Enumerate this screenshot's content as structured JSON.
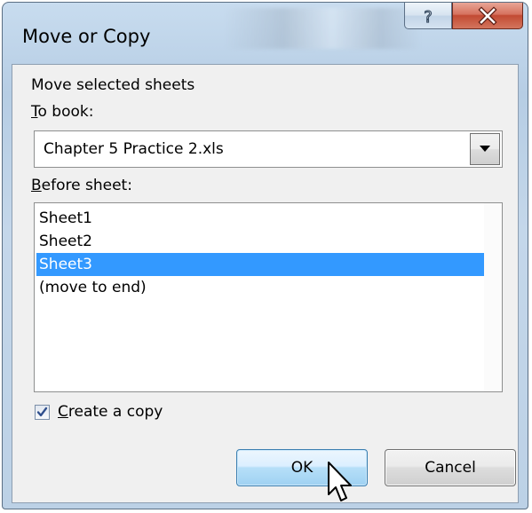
{
  "window": {
    "title": "Move or Copy",
    "help_glyph": "?",
    "close_glyph": "X"
  },
  "dialog": {
    "intro_text": "Move selected sheets",
    "to_book_label_underlined": "T",
    "to_book_label_rest": "o book:",
    "to_book_value": "Chapter 5 Practice 2.xls",
    "before_sheet_label_underlined": "B",
    "before_sheet_label_rest": "efore sheet:",
    "sheets": [
      {
        "label": "Sheet1",
        "selected": false
      },
      {
        "label": "Sheet2",
        "selected": false
      },
      {
        "label": "Sheet3",
        "selected": true
      },
      {
        "label": "(move to end)",
        "selected": false
      }
    ],
    "create_copy_checked": true,
    "create_copy_label_underlined": "C",
    "create_copy_label_rest": "reate a copy",
    "ok_label": "OK",
    "cancel_label": "Cancel"
  },
  "icons": {
    "help": "help-icon",
    "close": "close-icon",
    "dropdown": "chevron-down-icon",
    "scroll_up": "scroll-up-icon",
    "scroll_down": "scroll-down-icon",
    "checkmark": "checkmark-icon",
    "cursor": "mouse-pointer-icon"
  },
  "colors": {
    "selection": "#3399ff",
    "title_frame": "#c8dcef",
    "close_button": "#c24a33",
    "ok_button": "#b6dff8"
  }
}
